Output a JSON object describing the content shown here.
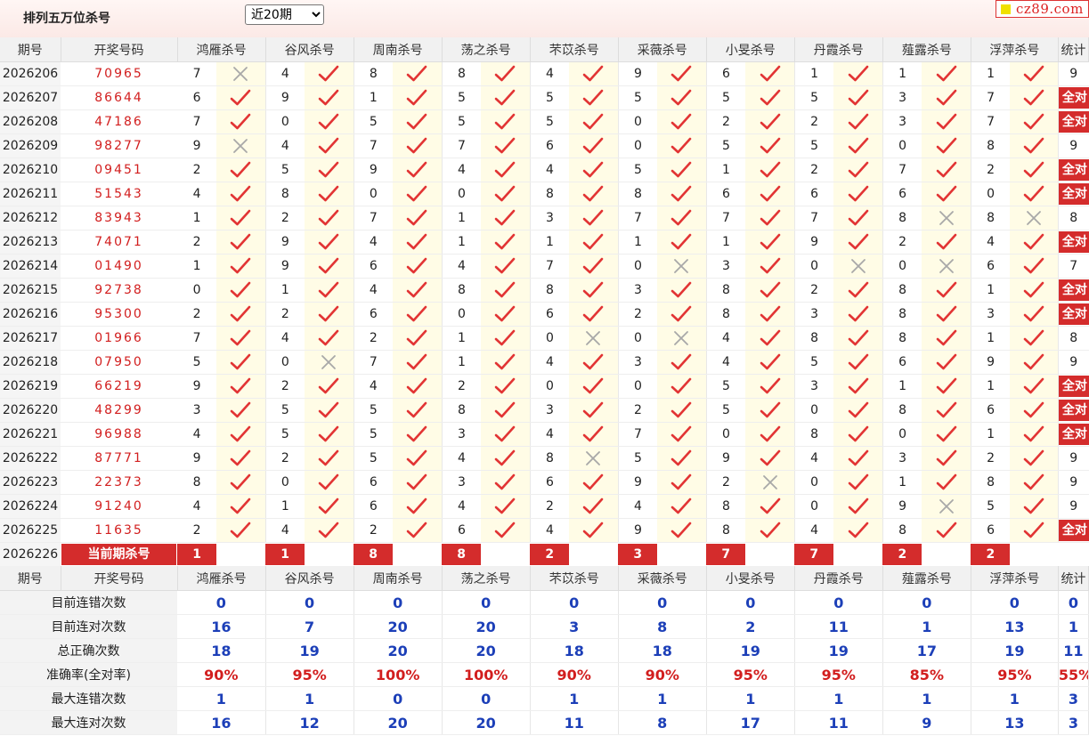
{
  "page": {
    "title": "排列五万位杀号",
    "period_select": "近20期",
    "brand": "cz89.com"
  },
  "headers": {
    "issue": "期号",
    "draw": "开奖号码",
    "experts": [
      "鸿雁杀号",
      "谷风杀号",
      "周南杀号",
      "荡之杀号",
      "芣苡杀号",
      "采薇杀号",
      "小旻杀号",
      "丹霞杀号",
      "薤露杀号",
      "浮萍杀号"
    ],
    "stat": "统计"
  },
  "rows": [
    {
      "issue": "2026206",
      "draw": "70965",
      "picks": [
        "7",
        "4",
        "8",
        "8",
        "4",
        "9",
        "6",
        "1",
        "1",
        "1"
      ],
      "ok": [
        false,
        true,
        true,
        true,
        true,
        true,
        true,
        true,
        true,
        true
      ],
      "stat": "9"
    },
    {
      "issue": "2026207",
      "draw": "86644",
      "picks": [
        "6",
        "9",
        "1",
        "5",
        "5",
        "5",
        "5",
        "5",
        "3",
        "7"
      ],
      "ok": [
        true,
        true,
        true,
        true,
        true,
        true,
        true,
        true,
        true,
        true
      ],
      "stat": "全对"
    },
    {
      "issue": "2026208",
      "draw": "47186",
      "picks": [
        "7",
        "0",
        "5",
        "5",
        "5",
        "0",
        "2",
        "2",
        "3",
        "7"
      ],
      "ok": [
        true,
        true,
        true,
        true,
        true,
        true,
        true,
        true,
        true,
        true
      ],
      "stat": "全对"
    },
    {
      "issue": "2026209",
      "draw": "98277",
      "picks": [
        "9",
        "4",
        "7",
        "7",
        "6",
        "0",
        "5",
        "5",
        "0",
        "8"
      ],
      "ok": [
        false,
        true,
        true,
        true,
        true,
        true,
        true,
        true,
        true,
        true
      ],
      "stat": "9"
    },
    {
      "issue": "2026210",
      "draw": "09451",
      "picks": [
        "2",
        "5",
        "9",
        "4",
        "4",
        "5",
        "1",
        "2",
        "7",
        "2"
      ],
      "ok": [
        true,
        true,
        true,
        true,
        true,
        true,
        true,
        true,
        true,
        true
      ],
      "stat": "全对"
    },
    {
      "issue": "2026211",
      "draw": "51543",
      "picks": [
        "4",
        "8",
        "0",
        "0",
        "8",
        "8",
        "6",
        "6",
        "6",
        "0"
      ],
      "ok": [
        true,
        true,
        true,
        true,
        true,
        true,
        true,
        true,
        true,
        true
      ],
      "stat": "全对"
    },
    {
      "issue": "2026212",
      "draw": "83943",
      "picks": [
        "1",
        "2",
        "7",
        "1",
        "3",
        "7",
        "7",
        "7",
        "8",
        "8"
      ],
      "ok": [
        true,
        true,
        true,
        true,
        true,
        true,
        true,
        true,
        false,
        false
      ],
      "stat": "8"
    },
    {
      "issue": "2026213",
      "draw": "74071",
      "picks": [
        "2",
        "9",
        "4",
        "1",
        "1",
        "1",
        "1",
        "9",
        "2",
        "4"
      ],
      "ok": [
        true,
        true,
        true,
        true,
        true,
        true,
        true,
        true,
        true,
        true
      ],
      "stat": "全对"
    },
    {
      "issue": "2026214",
      "draw": "01490",
      "picks": [
        "1",
        "9",
        "6",
        "4",
        "7",
        "0",
        "3",
        "0",
        "0",
        "6"
      ],
      "ok": [
        true,
        true,
        true,
        true,
        true,
        false,
        true,
        false,
        false,
        true
      ],
      "stat": "7"
    },
    {
      "issue": "2026215",
      "draw": "92738",
      "picks": [
        "0",
        "1",
        "4",
        "8",
        "8",
        "3",
        "8",
        "2",
        "8",
        "1"
      ],
      "ok": [
        true,
        true,
        true,
        true,
        true,
        true,
        true,
        true,
        true,
        true
      ],
      "stat": "全对"
    },
    {
      "issue": "2026216",
      "draw": "95300",
      "picks": [
        "2",
        "2",
        "6",
        "0",
        "6",
        "2",
        "8",
        "3",
        "8",
        "3"
      ],
      "ok": [
        true,
        true,
        true,
        true,
        true,
        true,
        true,
        true,
        true,
        true
      ],
      "stat": "全对"
    },
    {
      "issue": "2026217",
      "draw": "01966",
      "picks": [
        "7",
        "4",
        "2",
        "1",
        "0",
        "0",
        "4",
        "8",
        "8",
        "1"
      ],
      "ok": [
        true,
        true,
        true,
        true,
        false,
        false,
        true,
        true,
        true,
        true
      ],
      "stat": "8"
    },
    {
      "issue": "2026218",
      "draw": "07950",
      "picks": [
        "5",
        "0",
        "7",
        "1",
        "4",
        "3",
        "4",
        "5",
        "6",
        "9"
      ],
      "ok": [
        true,
        false,
        true,
        true,
        true,
        true,
        true,
        true,
        true,
        true
      ],
      "stat": "9"
    },
    {
      "issue": "2026219",
      "draw": "66219",
      "picks": [
        "9",
        "2",
        "4",
        "2",
        "0",
        "0",
        "5",
        "3",
        "1",
        "1"
      ],
      "ok": [
        true,
        true,
        true,
        true,
        true,
        true,
        true,
        true,
        true,
        true
      ],
      "stat": "全对"
    },
    {
      "issue": "2026220",
      "draw": "48299",
      "picks": [
        "3",
        "5",
        "5",
        "8",
        "3",
        "2",
        "5",
        "0",
        "8",
        "6"
      ],
      "ok": [
        true,
        true,
        true,
        true,
        true,
        true,
        true,
        true,
        true,
        true
      ],
      "stat": "全对"
    },
    {
      "issue": "2026221",
      "draw": "96988",
      "picks": [
        "4",
        "5",
        "5",
        "3",
        "4",
        "7",
        "0",
        "8",
        "0",
        "1"
      ],
      "ok": [
        true,
        true,
        true,
        true,
        true,
        true,
        true,
        true,
        true,
        true
      ],
      "stat": "全对"
    },
    {
      "issue": "2026222",
      "draw": "87771",
      "picks": [
        "9",
        "2",
        "5",
        "4",
        "8",
        "5",
        "9",
        "4",
        "3",
        "2"
      ],
      "ok": [
        true,
        true,
        true,
        true,
        false,
        true,
        true,
        true,
        true,
        true
      ],
      "stat": "9"
    },
    {
      "issue": "2026223",
      "draw": "22373",
      "picks": [
        "8",
        "0",
        "6",
        "3",
        "6",
        "9",
        "2",
        "0",
        "1",
        "8"
      ],
      "ok": [
        true,
        true,
        true,
        true,
        true,
        true,
        false,
        true,
        true,
        true
      ],
      "stat": "9"
    },
    {
      "issue": "2026224",
      "draw": "91240",
      "picks": [
        "4",
        "1",
        "6",
        "4",
        "2",
        "4",
        "8",
        "0",
        "9",
        "5"
      ],
      "ok": [
        true,
        true,
        true,
        true,
        true,
        true,
        true,
        true,
        false,
        true
      ],
      "stat": "9"
    },
    {
      "issue": "2026225",
      "draw": "11635",
      "picks": [
        "2",
        "4",
        "2",
        "6",
        "4",
        "9",
        "8",
        "4",
        "8",
        "6"
      ],
      "ok": [
        true,
        true,
        true,
        true,
        true,
        true,
        true,
        true,
        true,
        true
      ],
      "stat": "全对"
    }
  ],
  "current": {
    "issue": "2026226",
    "label": "当前期杀号",
    "picks": [
      "1",
      "1",
      "8",
      "8",
      "2",
      "3",
      "7",
      "7",
      "2",
      "2"
    ]
  },
  "stats": [
    {
      "label": "目前连错次数",
      "values": [
        "0",
        "0",
        "0",
        "0",
        "0",
        "0",
        "0",
        "0",
        "0",
        "0"
      ],
      "total": "0"
    },
    {
      "label": "目前连对次数",
      "values": [
        "16",
        "7",
        "20",
        "20",
        "3",
        "8",
        "2",
        "11",
        "1",
        "13"
      ],
      "total": "1"
    },
    {
      "label": "总正确次数",
      "values": [
        "18",
        "19",
        "20",
        "20",
        "18",
        "18",
        "19",
        "19",
        "17",
        "19"
      ],
      "total": "11"
    },
    {
      "label": "准确率(全对率)",
      "values": [
        "90%",
        "95%",
        "100%",
        "100%",
        "90%",
        "90%",
        "95%",
        "95%",
        "85%",
        "95%"
      ],
      "total": "55%"
    },
    {
      "label": "最大连错次数",
      "values": [
        "1",
        "1",
        "0",
        "0",
        "1",
        "1",
        "1",
        "1",
        "1",
        "1"
      ],
      "total": "3"
    },
    {
      "label": "最大连对次数",
      "values": [
        "16",
        "12",
        "20",
        "20",
        "11",
        "8",
        "17",
        "11",
        "9",
        "13"
      ],
      "total": "3"
    }
  ],
  "icons": {
    "correct": "check-icon",
    "wrong": "cross-icon"
  },
  "colors": {
    "accent": "#d42c2c",
    "stat_blue": "#1c3fb8",
    "draw_red": "#d21e1e"
  }
}
